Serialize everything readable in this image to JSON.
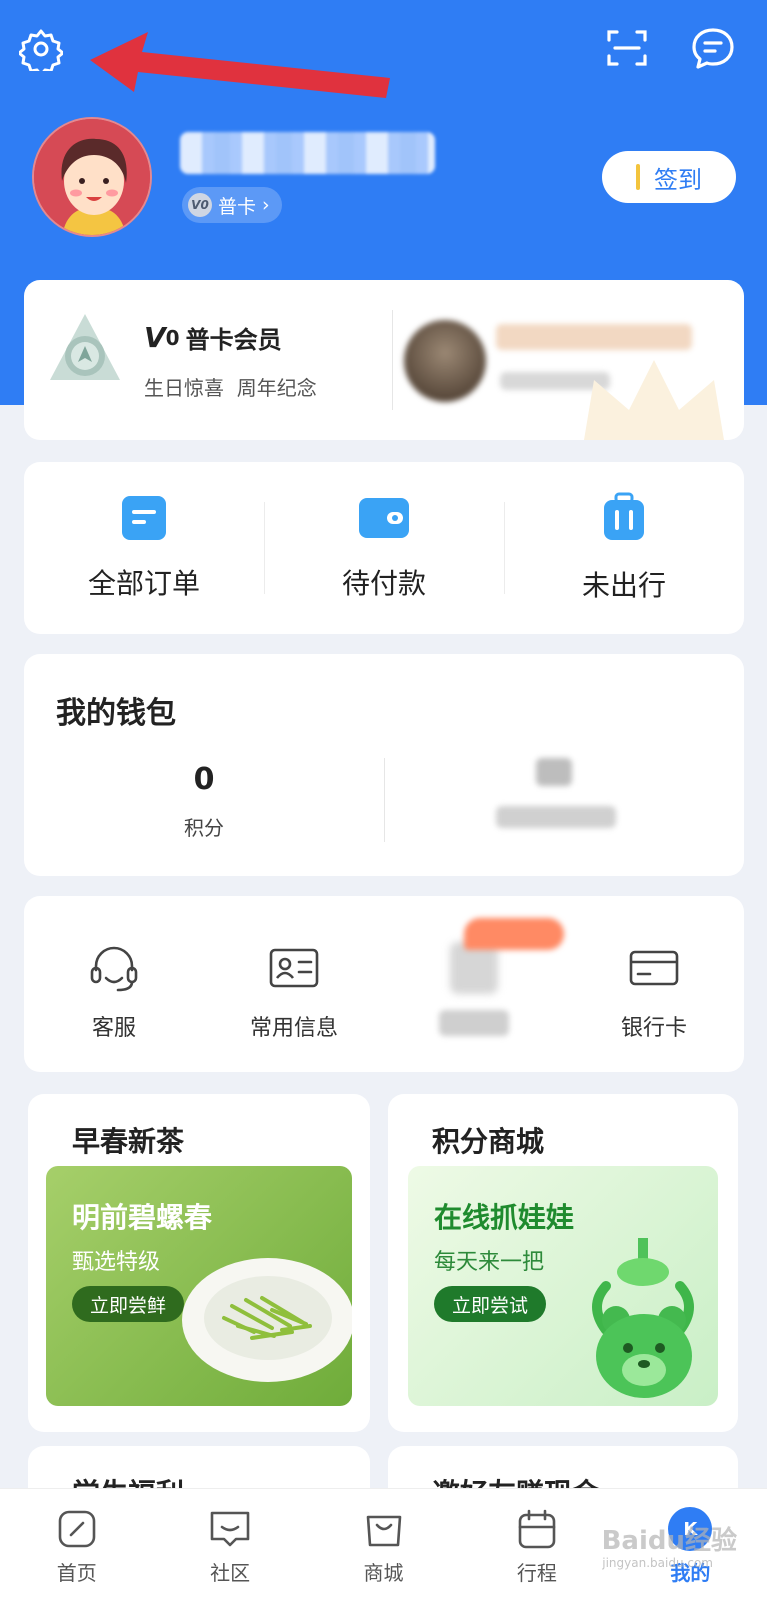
{
  "header": {
    "level_badge": "V0",
    "level_label": "普卡",
    "checkin_label": "签到"
  },
  "member_card": {
    "title_mark": "V",
    "title_level": "0",
    "title": "普卡会员",
    "subtitle": "生日惊喜  周年纪念"
  },
  "orders": [
    {
      "label": "全部订单",
      "icon": "all-orders-icon"
    },
    {
      "label": "待付款",
      "icon": "wallet-pay-icon"
    },
    {
      "label": "未出行",
      "icon": "luggage-icon"
    }
  ],
  "wallet": {
    "title": "我的钱包",
    "points_value": "0",
    "points_label": "积分"
  },
  "services": [
    {
      "label": "客服",
      "icon": "headset-icon"
    },
    {
      "label": "常用信息",
      "icon": "id-card-icon"
    },
    {
      "label": "",
      "icon": "blurred-icon"
    },
    {
      "label": "银行卡",
      "icon": "bank-card-icon"
    }
  ],
  "promos": [
    {
      "title": "早春新茶",
      "headline": "明前碧螺春",
      "sub": "甄选特级",
      "button": "立即尝鲜"
    },
    {
      "title": "积分商城",
      "headline": "在线抓娃娃",
      "sub": "每天来一把",
      "button": "立即尝试"
    }
  ],
  "partial_promos": [
    "学生福利",
    "邀好友赚现金"
  ],
  "tabbar": [
    {
      "label": "首页",
      "icon": "home-icon"
    },
    {
      "label": "社区",
      "icon": "community-icon"
    },
    {
      "label": "商城",
      "icon": "shopping-bag-icon"
    },
    {
      "label": "行程",
      "icon": "calendar-icon"
    },
    {
      "label": "我的",
      "icon": "profile-icon",
      "active": true
    }
  ],
  "watermark": {
    "text": "Baidu经验",
    "sub": "jingyan.baidu.com"
  },
  "colors": {
    "brand": "#2f7df4",
    "checkin_accent": "#f3c43d",
    "tea_green": "#8cbf4a",
    "game_green": "#2e9d3a"
  }
}
